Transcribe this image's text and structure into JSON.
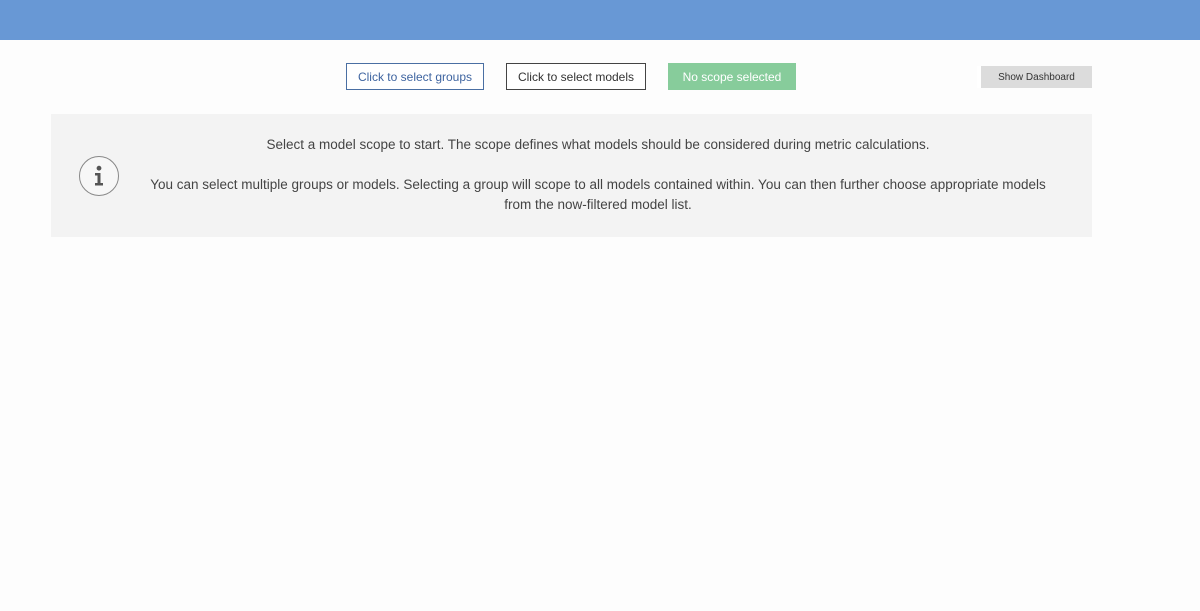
{
  "toolbar": {
    "groups_button": "Click to select groups",
    "models_button": "Click to select models",
    "scope_status": "No scope selected",
    "dashboard_button": "Show Dashboard"
  },
  "info_panel": {
    "icon": "info-icon",
    "line1": "Select a model scope to start. The scope defines what models should be considered during metric calculations.",
    "line2": "You can select multiple groups or models. Selecting a group will scope to all models contained within. You can then further choose appropriate models",
    "line3": "from the now-filtered model list."
  },
  "colors": {
    "header": "#6898d5",
    "scope_badge": "#87cc9b",
    "panel_background": "#f3f3f3"
  }
}
